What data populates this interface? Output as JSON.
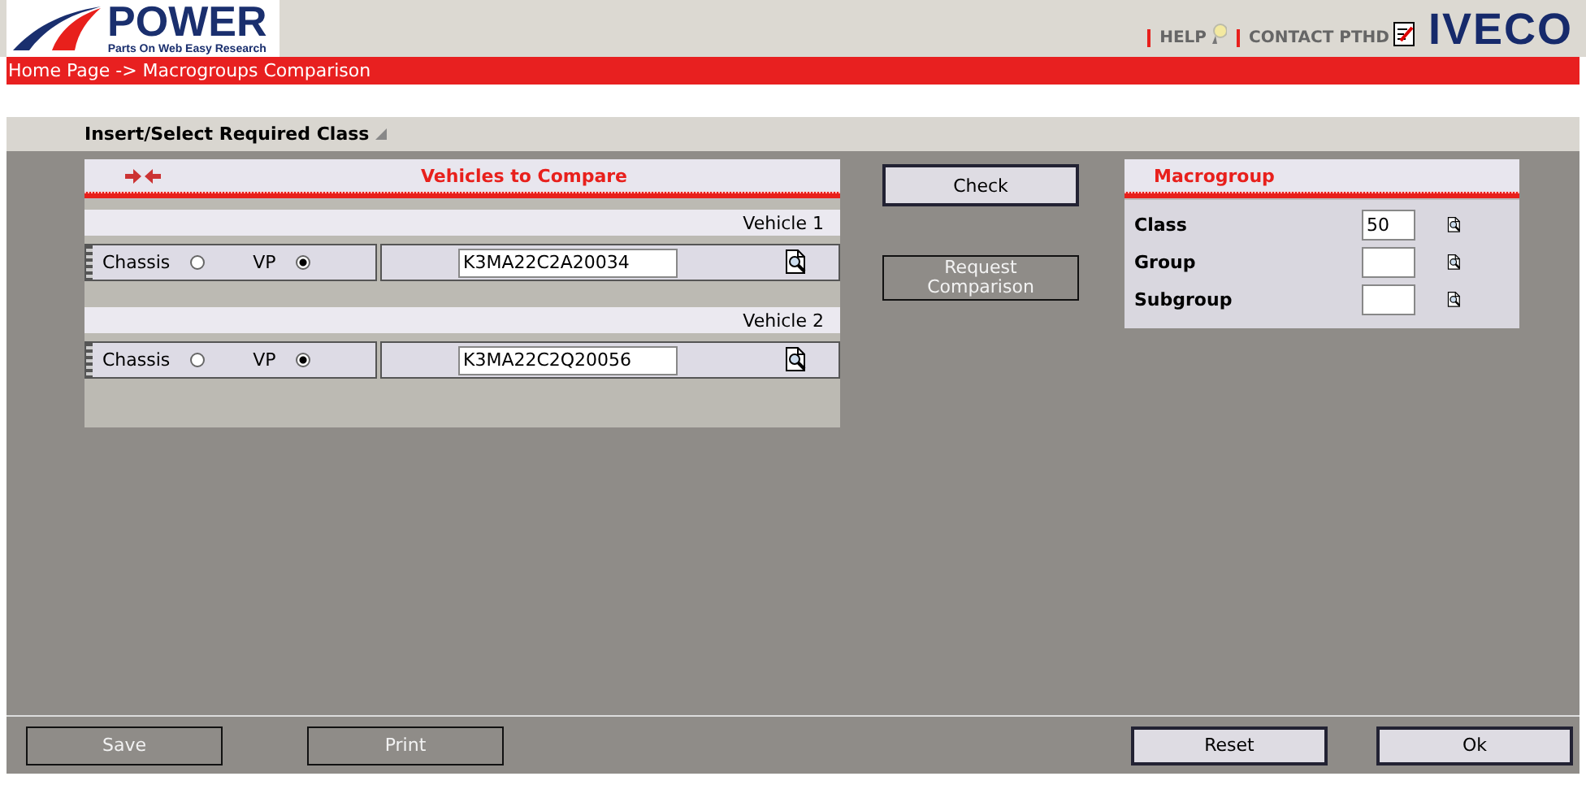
{
  "header": {
    "logo": "POWER",
    "tagline": "Parts On Web Easy Research",
    "links": [
      {
        "label": "HELP",
        "kind": "help"
      },
      {
        "label": "CONTACT PTHD",
        "kind": "contact"
      }
    ],
    "brand": "IVECO"
  },
  "breadcrumb": "Home Page -> Macrogroups Comparison",
  "section_title": "Insert/Select Required Class",
  "vehicles": {
    "title": "Vehicles to Compare",
    "items": [
      {
        "label": "Vehicle 1",
        "options": [
          {
            "label": "Chassis",
            "selected": false
          },
          {
            "label": "VP",
            "selected": true
          }
        ],
        "value": "K3MA22C2A20034"
      },
      {
        "label": "Vehicle 2",
        "options": [
          {
            "label": "Chassis",
            "selected": false
          },
          {
            "label": "VP",
            "selected": true
          }
        ],
        "value": "K3MA22C2Q20056"
      }
    ]
  },
  "actions": [
    {
      "label": "Check",
      "disabled": false
    },
    {
      "label": "Request Comparison",
      "disabled": true
    }
  ],
  "macrogroup": {
    "title": "Macrogroup",
    "fields": [
      {
        "label": "Class",
        "value": "50"
      },
      {
        "label": "Group"
      },
      {
        "label": "Subgroup"
      }
    ]
  },
  "footer": {
    "left": [
      {
        "label": "Save",
        "disabled": true
      },
      {
        "label": "Print",
        "disabled": true
      }
    ],
    "right": [
      {
        "label": "Reset",
        "disabled": false
      },
      {
        "label": "Ok",
        "disabled": false
      }
    ]
  }
}
